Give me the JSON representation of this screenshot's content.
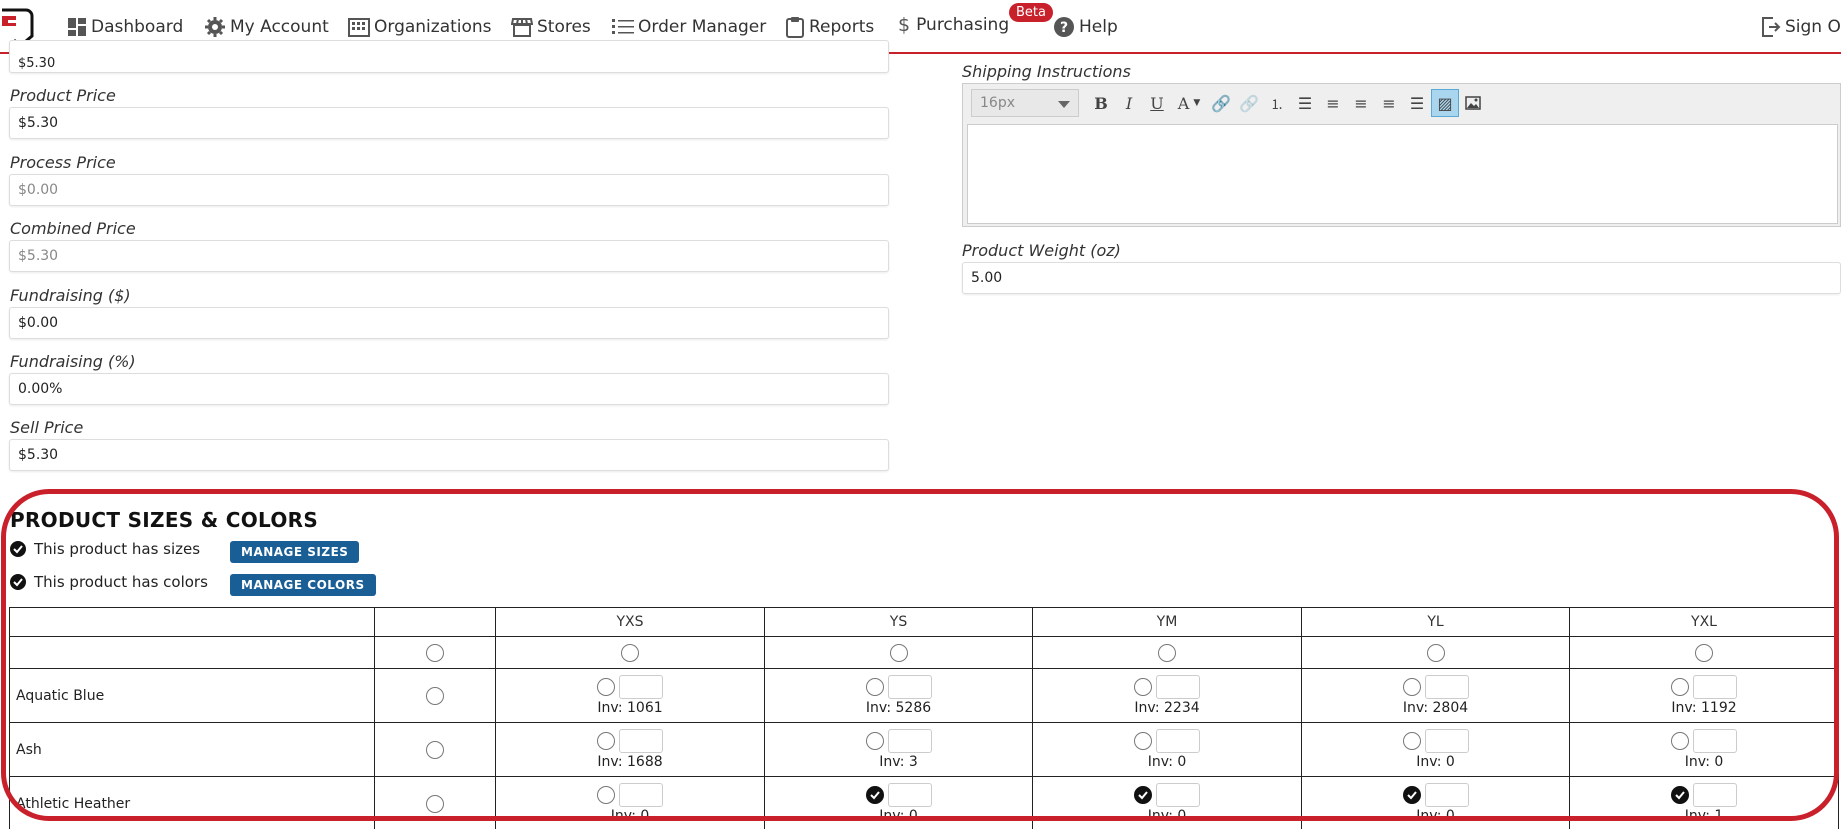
{
  "nav": {
    "items": [
      {
        "label": "Dashboard",
        "icon": "dashboard-icon"
      },
      {
        "label": "My Account",
        "icon": "gear-icon"
      },
      {
        "label": "Organizations",
        "icon": "building-icon"
      },
      {
        "label": "Stores",
        "icon": "store-icon"
      },
      {
        "label": "Order Manager",
        "icon": "list-icon"
      },
      {
        "label": "Reports",
        "icon": "clipboard-icon"
      },
      {
        "label": "Purchasing",
        "icon": "dollar-icon"
      },
      {
        "label": "Help",
        "icon": "help-icon"
      }
    ],
    "beta": "Beta",
    "sign_out": "Sign O",
    "accent": "#c9212b"
  },
  "form": {
    "top_partial_value": "$5.30",
    "product_price": {
      "label": "Product Price",
      "value": "$5.30"
    },
    "process_price": {
      "label": "Process Price",
      "value": "$0.00"
    },
    "combined_price": {
      "label": "Combined Price",
      "value": "$5.30"
    },
    "fundraising_dollars": {
      "label": "Fundraising ($)",
      "value": "$0.00"
    },
    "fundraising_percent": {
      "label": "Fundraising (%)",
      "value": "0.00%"
    },
    "sell_price": {
      "label": "Sell Price",
      "value": "$5.30"
    },
    "shipping_instructions": {
      "label": "Shipping Instructions",
      "font_size": "16px"
    },
    "product_weight": {
      "label": "Product Weight (oz)",
      "value": "5.00"
    }
  },
  "sizes_colors": {
    "title": "PRODUCT SIZES & COLORS",
    "has_sizes": "This product has sizes",
    "has_colors": "This product has colors",
    "manage_sizes": "MANAGE SIZES",
    "manage_colors": "MANAGE COLORS",
    "sizes": [
      "YXS",
      "YS",
      "YM",
      "YL",
      "YXL"
    ],
    "rows": [
      {
        "name": "Aquatic Blue",
        "inv": [
          "Inv: 1061",
          "Inv: 5286",
          "Inv: 2234",
          "Inv: 2804",
          "Inv: 1192"
        ],
        "checked": [
          false,
          false,
          false,
          false,
          false
        ]
      },
      {
        "name": "Ash",
        "inv": [
          "Inv: 1688",
          "Inv: 3",
          "Inv: 0",
          "Inv: 0",
          "Inv: 0"
        ],
        "checked": [
          false,
          false,
          false,
          false,
          false
        ]
      },
      {
        "name": "Athletic Heather",
        "inv": [
          "Inv: 0",
          "Inv: 0",
          "Inv: 0",
          "Inv: 0",
          "Inv: 1"
        ],
        "checked": [
          false,
          true,
          true,
          true,
          true
        ]
      }
    ]
  }
}
